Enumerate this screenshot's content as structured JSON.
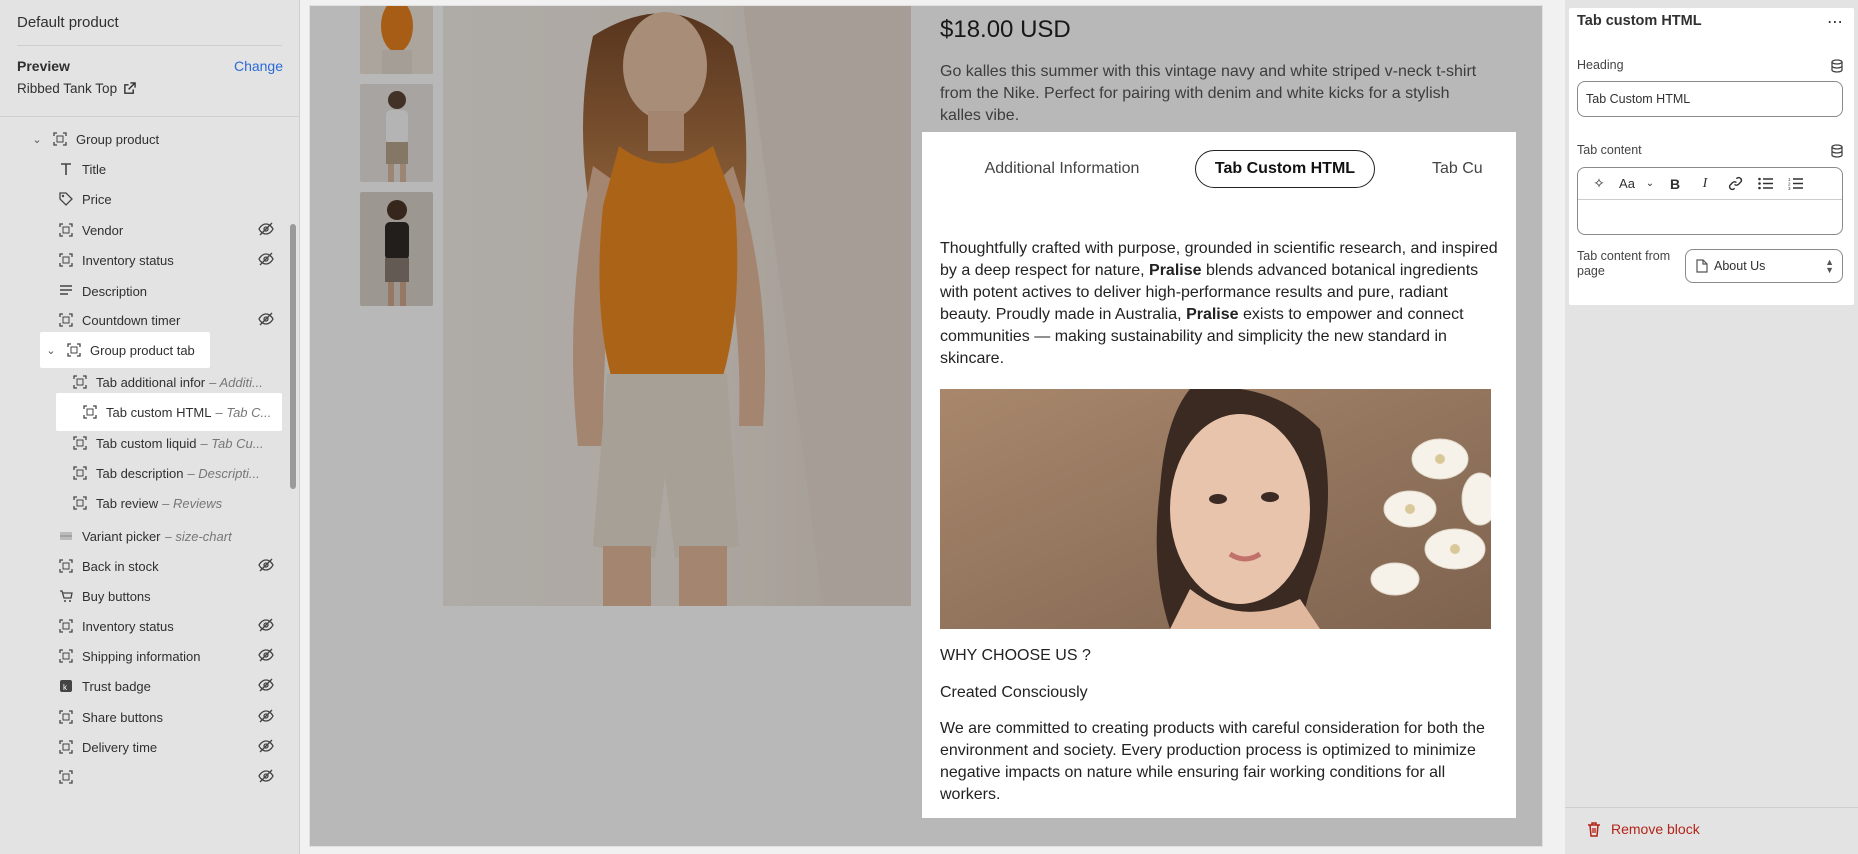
{
  "sidebar": {
    "header": "Default product",
    "preview_label": "Preview",
    "change_label": "Change",
    "preview_value": "Ribbed Tank Top",
    "tree": [
      {
        "label": "Group product",
        "sub": "",
        "hidden": false,
        "icon": "block-icon",
        "chevron": "down"
      },
      {
        "label": "Title",
        "sub": "",
        "hidden": false,
        "icon": "title-icon"
      },
      {
        "label": "Price",
        "sub": "",
        "hidden": false,
        "icon": "price-tag-icon"
      },
      {
        "label": "Vendor",
        "sub": "",
        "hidden": true,
        "icon": "block-icon"
      },
      {
        "label": "Inventory status",
        "sub": "",
        "hidden": true,
        "icon": "block-icon"
      },
      {
        "label": "Description",
        "sub": "",
        "hidden": false,
        "icon": "text-lines-icon"
      },
      {
        "label": "Countdown timer",
        "sub": "",
        "hidden": true,
        "icon": "block-icon"
      },
      {
        "label": "Group product tab",
        "sub": "",
        "hidden": false,
        "icon": "block-icon",
        "chevron": "down"
      },
      {
        "label": "Tab additional infor",
        "sub": "– Additi...",
        "hidden": false,
        "icon": "block-icon"
      },
      {
        "label": "Tab custom HTML",
        "sub": "– Tab C...",
        "hidden": false,
        "icon": "block-icon"
      },
      {
        "label": "Tab custom liquid",
        "sub": "– Tab Cu...",
        "hidden": false,
        "icon": "block-icon"
      },
      {
        "label": "Tab description",
        "sub": "– Descripti...",
        "hidden": false,
        "icon": "block-icon"
      },
      {
        "label": "Tab review",
        "sub": "– Reviews",
        "hidden": false,
        "icon": "block-icon"
      },
      {
        "label": "Variant picker",
        "sub": "– size-chart",
        "hidden": false,
        "icon": "variant-icon"
      },
      {
        "label": "Back in stock",
        "sub": "",
        "hidden": true,
        "icon": "block-icon"
      },
      {
        "label": "Buy buttons",
        "sub": "",
        "hidden": false,
        "icon": "cart-icon"
      },
      {
        "label": "Inventory status",
        "sub": "",
        "hidden": true,
        "icon": "block-icon"
      },
      {
        "label": "Shipping information",
        "sub": "",
        "hidden": true,
        "icon": "block-icon"
      },
      {
        "label": "Trust badge",
        "sub": "",
        "hidden": true,
        "icon": "badge-icon"
      },
      {
        "label": "Share buttons",
        "sub": "",
        "hidden": true,
        "icon": "block-icon"
      },
      {
        "label": "Delivery time",
        "sub": "",
        "hidden": true,
        "icon": "block-icon"
      },
      {
        "label": "",
        "sub": "",
        "hidden": true,
        "icon": "block-icon"
      }
    ]
  },
  "product": {
    "price": "$18.00 USD",
    "description": "Go kalles this summer with this vintage navy and white striped v-neck t-shirt from the Nike. Perfect for pairing with denim and white kicks for a stylish kalles vibe."
  },
  "tabs": {
    "items": [
      "Additional Information",
      "Tab Custom HTML",
      "Tab Cu"
    ],
    "active_index": 1,
    "body_part1": "Thoughtfully crafted with purpose, grounded in scientific research, and inspired by a deep respect for nature, ",
    "brand": "Pralise",
    "body_part2": " blends advanced botanical ingredients with potent actives to deliver high-performance results and pure, radiant beauty. Proudly made in Australia, ",
    "body_part3": " exists to empower and connect communities — making sustainability and simplicity the new standard in skincare.",
    "why_heading": "WHY CHOOSE US ?",
    "sub_heading": "Created Consciously",
    "paragraph": "We are committed to creating products with careful consideration for both the environment and society. Every production process is optimized to minimize negative impacts on nature while ensuring fair working conditions for all workers."
  },
  "settings": {
    "title": "Tab custom HTML",
    "more_label": "⋯",
    "heading_label": "Heading",
    "heading_value": "Tab Custom HTML",
    "content_label": "Tab content",
    "content_from_page_label": "Tab content from page",
    "page_select_value": "About Us",
    "remove_label": "Remove block"
  },
  "colors": {
    "link": "#2a6ad8",
    "danger": "#b42318",
    "accent_orange": "#e8821e"
  }
}
